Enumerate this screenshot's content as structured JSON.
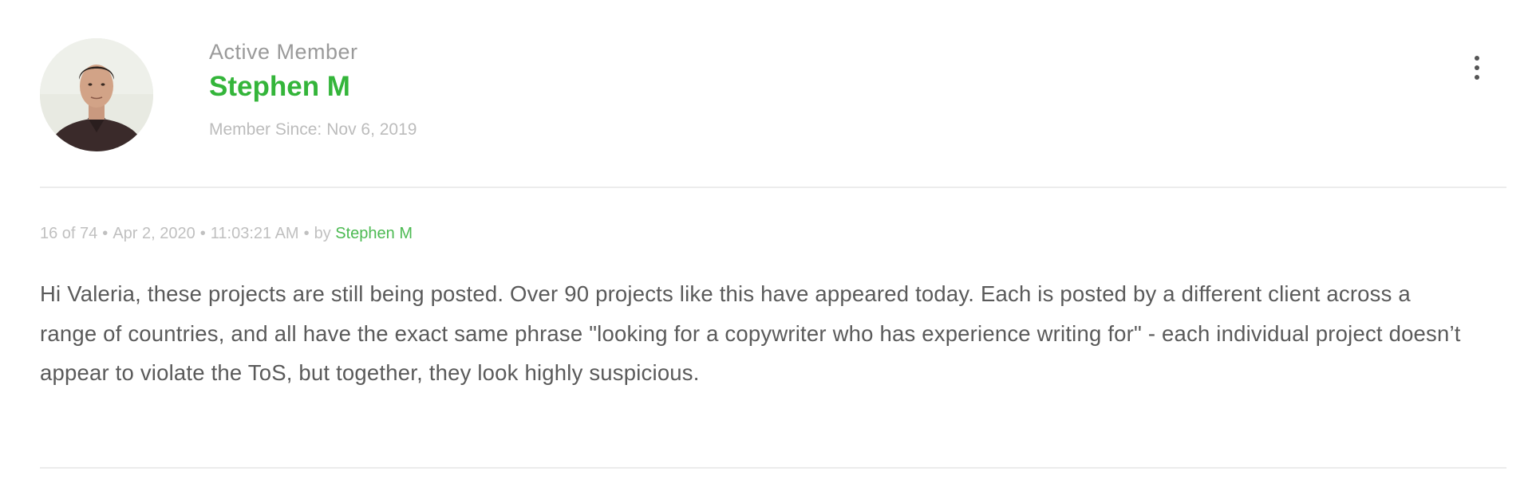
{
  "member": {
    "rank": "Active Member",
    "name": "Stephen M",
    "since_label": "Member Since:",
    "since_date": "Nov 6, 2019"
  },
  "post": {
    "position": "16 of 74",
    "date": "Apr 2, 2020",
    "time": "11:03:21 AM",
    "by_label": "by",
    "author": "Stephen M",
    "body": "Hi Valeria, these projects are still being posted. Over 90 projects like this have appeared today. Each is posted by a different client across a range of countries, and all have the exact same phrase \"looking for a copywriter who has experience writing for\" - each individual project doesn’t appear to violate the ToS, but together, they look highly suspicious."
  },
  "icons": {
    "menu": "vertical-ellipsis-icon",
    "avatar": "user-avatar"
  },
  "colors": {
    "accent_green": "#34b53a",
    "rank_gray": "#9a9a9a",
    "meta_gray": "#c0c0c0",
    "body_text": "#5a5a5a",
    "divider": "#ececec"
  }
}
